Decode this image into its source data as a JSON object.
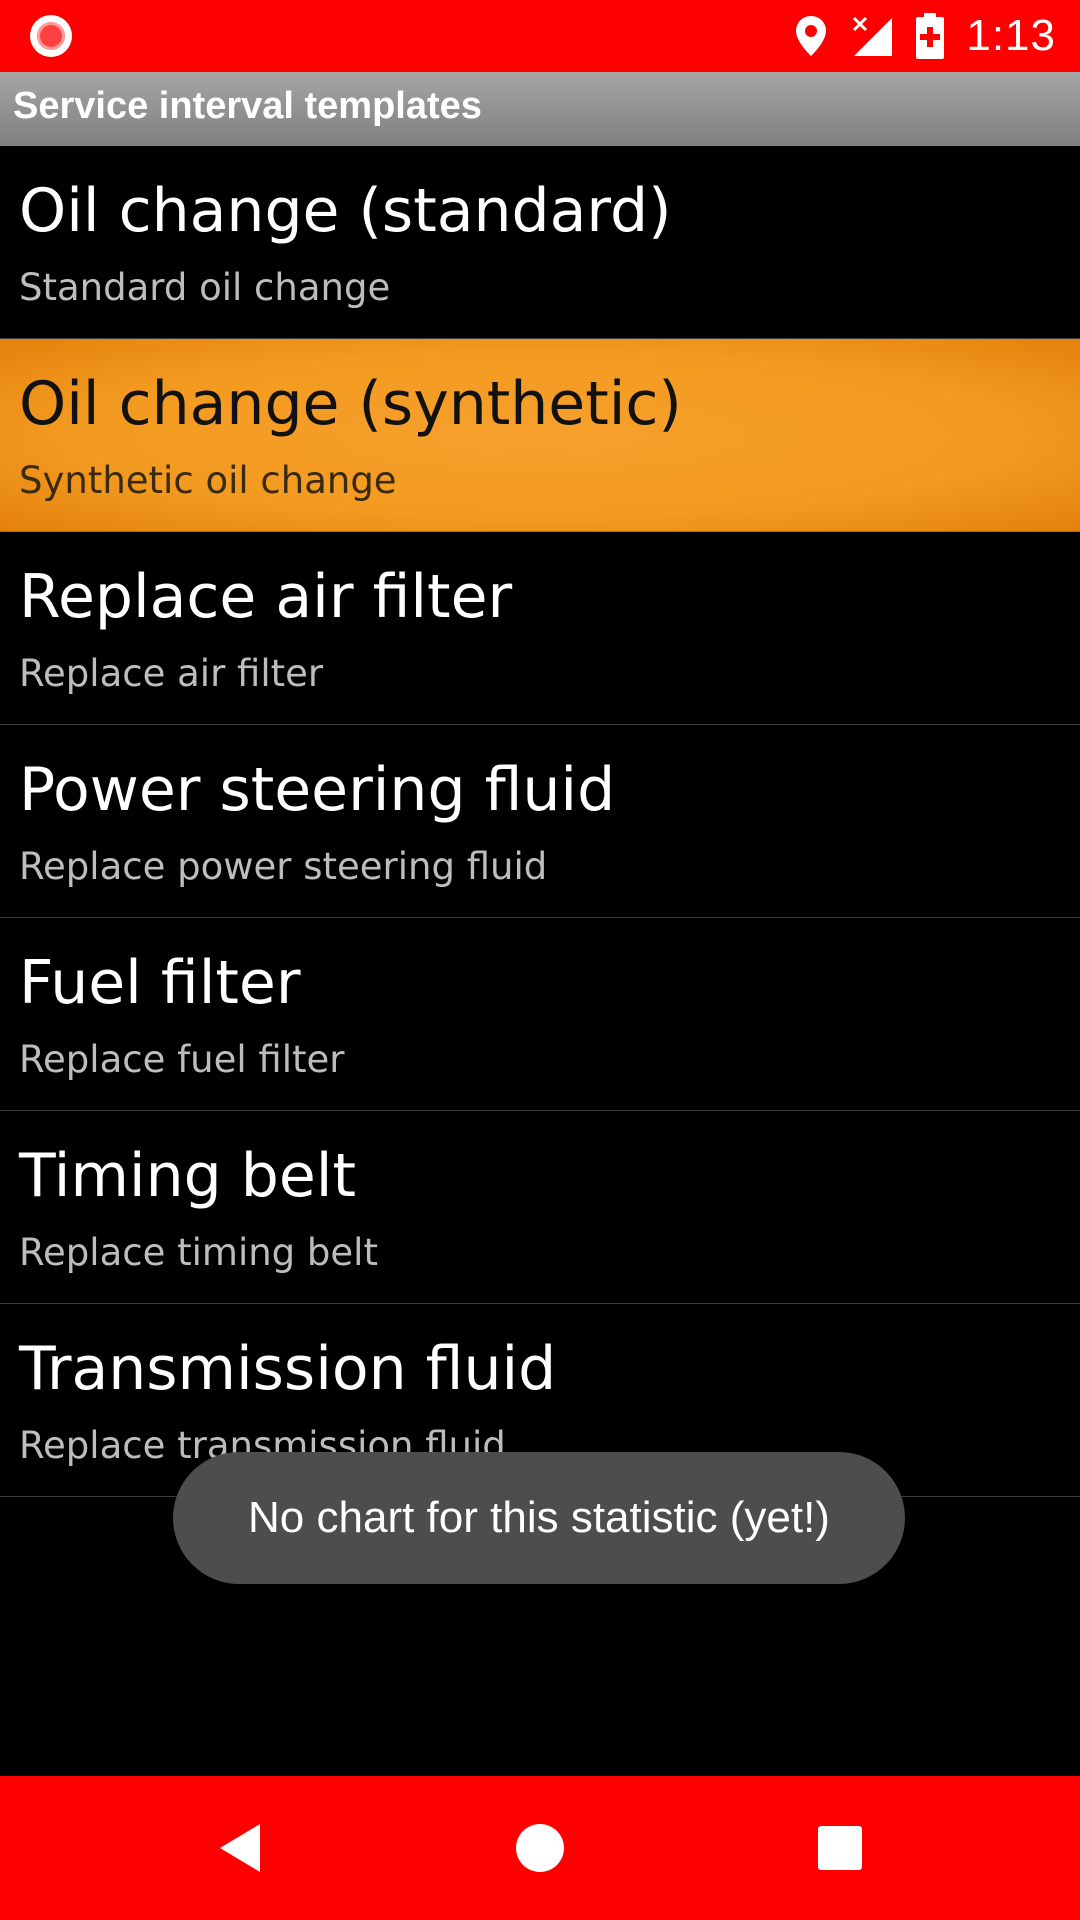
{
  "status_bar": {
    "time": "1:13",
    "icons": [
      "recording-icon",
      "location-icon",
      "signal-off-icon",
      "battery-charging-icon"
    ]
  },
  "app_bar": {
    "title": "Service interval templates"
  },
  "list": {
    "items": [
      {
        "title": "Oil change (standard)",
        "subtitle": "Standard oil change",
        "selected": false
      },
      {
        "title": "Oil change (synthetic)",
        "subtitle": "Synthetic oil change",
        "selected": true
      },
      {
        "title": "Replace air filter",
        "subtitle": "Replace air filter",
        "selected": false
      },
      {
        "title": "Power steering fluid",
        "subtitle": "Replace power steering fluid",
        "selected": false
      },
      {
        "title": "Fuel filter",
        "subtitle": "Replace fuel filter",
        "selected": false
      },
      {
        "title": "Timing belt",
        "subtitle": "Replace timing belt",
        "selected": false
      },
      {
        "title": "Transmission fluid",
        "subtitle": "Replace transmission fluid",
        "selected": false
      }
    ]
  },
  "toast": {
    "message": "No chart for this statistic (yet!)"
  },
  "nav_bar": {
    "buttons": [
      "back-icon",
      "home-icon",
      "recents-icon"
    ]
  },
  "colors": {
    "status_bar": "#ff0000",
    "nav_bar": "#ff0000",
    "selected_item": "#f39a20",
    "background": "#000000"
  }
}
